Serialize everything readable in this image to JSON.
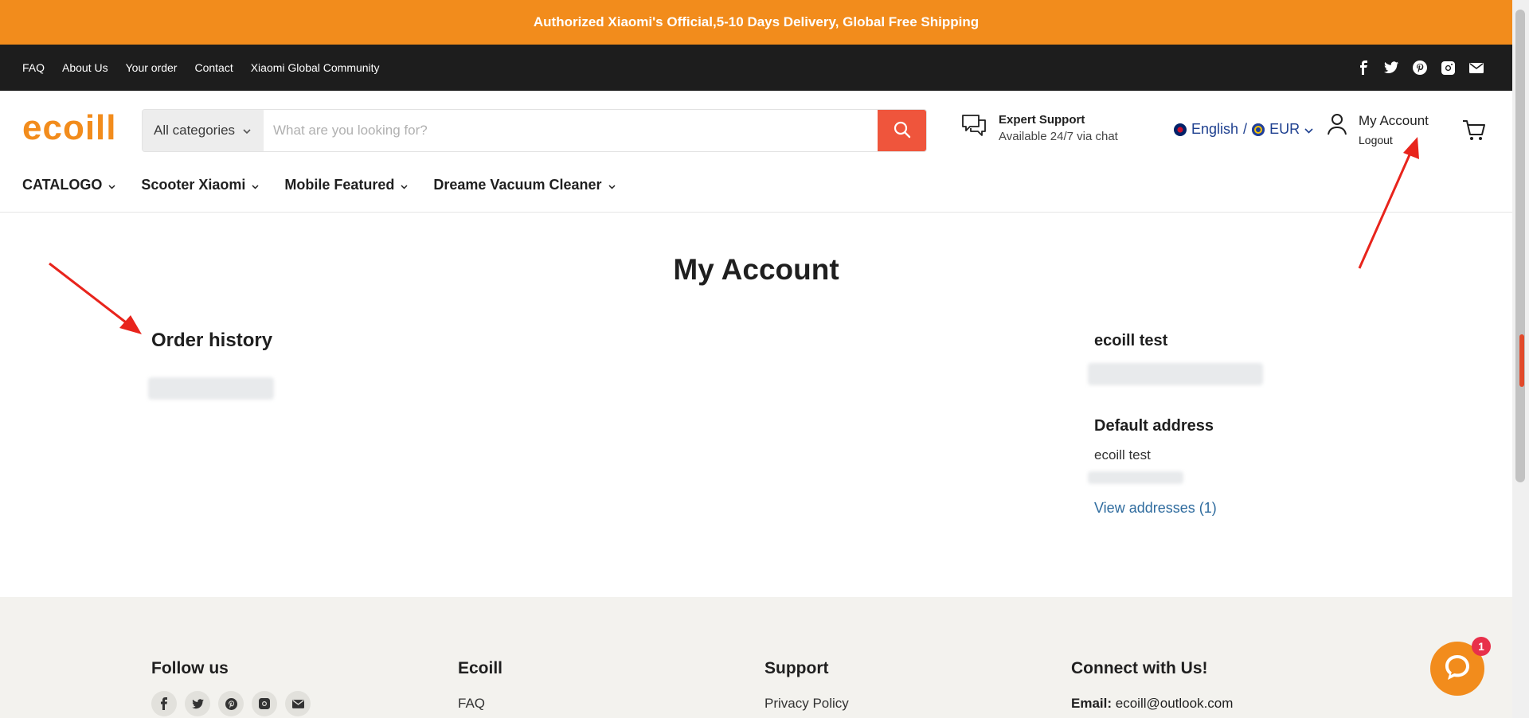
{
  "announcement": "Authorized Xiaomi's Official,5-10 Days Delivery, Global Free Shipping",
  "utility_links": [
    "FAQ",
    "About Us",
    "Your order",
    "Contact",
    "Xiaomi Global Community"
  ],
  "social_icons": [
    "facebook-icon",
    "twitter-icon",
    "pinterest-icon",
    "instagram-icon",
    "email-icon"
  ],
  "logo": "ecoill",
  "search": {
    "category": "All categories",
    "placeholder": "What are you looking for?"
  },
  "support": {
    "title": "Expert Support",
    "subtitle": "Available 24/7 via chat"
  },
  "locale": {
    "language": "English",
    "separator": "/",
    "currency": "EUR"
  },
  "account": {
    "title": "My Account",
    "logout": "Logout"
  },
  "nav": [
    "CATALOGO",
    "Scooter Xiaomi",
    "Mobile Featured",
    "Dreame Vacuum Cleaner"
  ],
  "main": {
    "page_title": "My Account",
    "order_history": "Order history",
    "customer_name": "ecoill test",
    "default_address_heading": "Default address",
    "address_name": "ecoill test",
    "view_addresses": "View addresses (1)"
  },
  "footer": {
    "follow_us": "Follow us",
    "ecoill_heading": "Ecoill",
    "ecoill_link": "FAQ",
    "support_heading": "Support",
    "support_link": "Privacy Policy",
    "connect_heading": "Connect with Us!",
    "email_label": "Email:",
    "email_value": "ecoill@outlook.com"
  },
  "chat_badge": "1",
  "colors": {
    "brand_orange": "#f28c1c",
    "search_red": "#ef553c",
    "link_blue": "#2e6b9e",
    "annotation_red": "#e8241c"
  }
}
